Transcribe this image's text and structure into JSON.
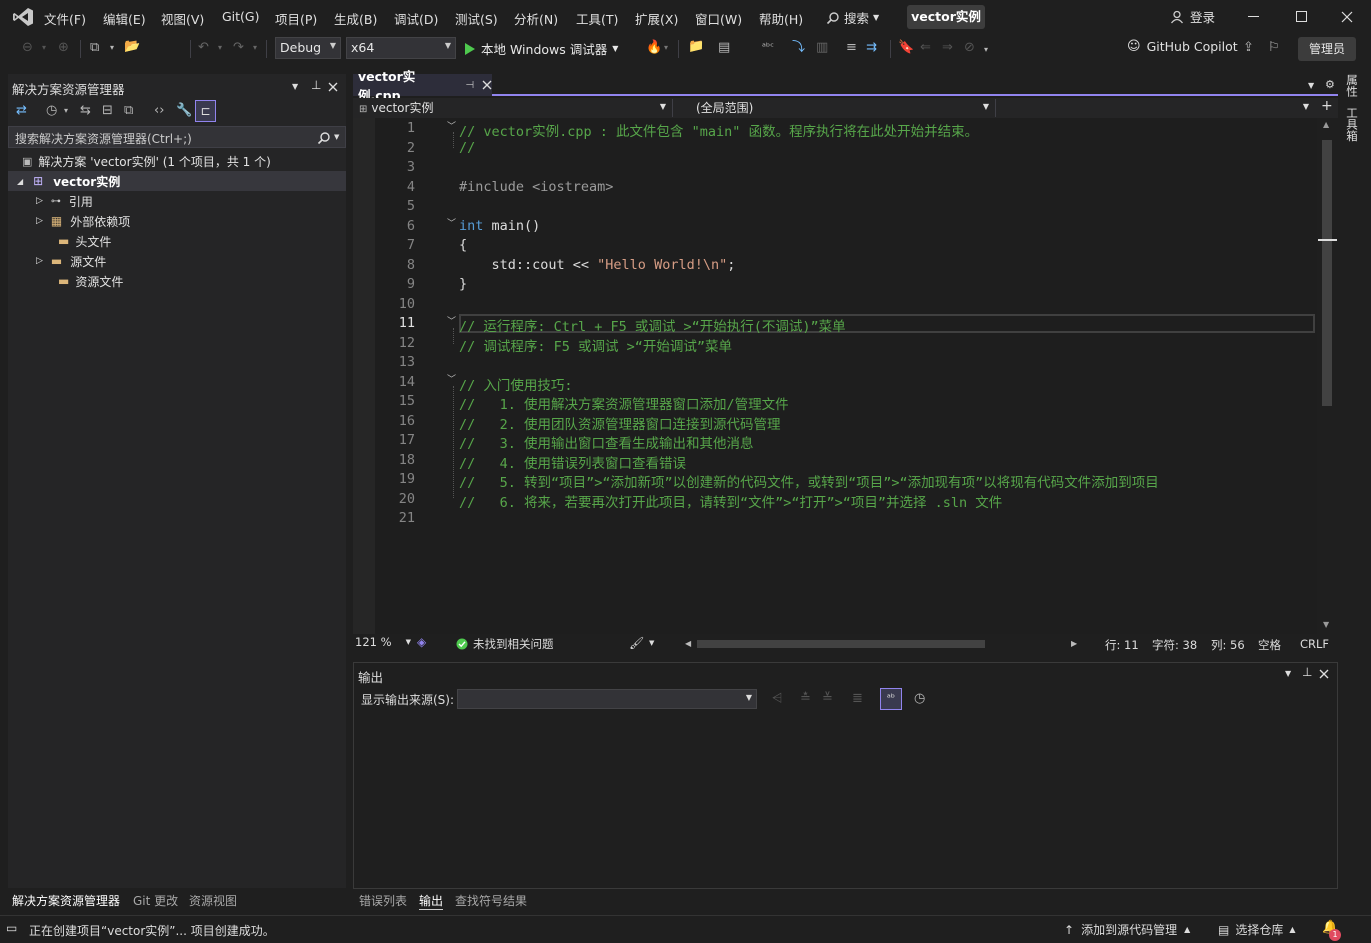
{
  "titlebar": {
    "menus": [
      "文件(F)",
      "编辑(E)",
      "视图(V)",
      "Git(G)",
      "项目(P)",
      "生成(B)",
      "调试(D)",
      "测试(S)",
      "分析(N)",
      "工具(T)",
      "扩展(X)",
      "窗口(W)",
      "帮助(H)"
    ],
    "search_label": "搜索",
    "project_name": "vector实例",
    "login_label": "登录"
  },
  "toolbar": {
    "config": "Debug",
    "platform": "x64",
    "run_label": "本地 Windows 调试器",
    "copilot_label": "GitHub Copilot",
    "admin_label": "管理员"
  },
  "solution_explorer": {
    "title": "解决方案资源管理器",
    "search_placeholder": "搜索解决方案资源管理器(Ctrl+;)",
    "solution_label": "解决方案 'vector实例' (1 个项目，共 1 个)",
    "project_label": "vector实例",
    "items": [
      "引用",
      "外部依赖项",
      "头文件",
      "源文件",
      "资源文件"
    ],
    "bottom_tabs": [
      "解决方案资源管理器",
      "Git 更改",
      "资源视图"
    ]
  },
  "editor": {
    "tab_label": "vector实例.cpp",
    "nav_project": "vector实例",
    "nav_scope": "(全局范围)",
    "line_numbers": [
      "1",
      "2",
      "3",
      "4",
      "5",
      "6",
      "7",
      "8",
      "9",
      "10",
      "11",
      "12",
      "13",
      "14",
      "15",
      "16",
      "17",
      "18",
      "19",
      "20",
      "21"
    ],
    "lines": {
      "l1": "// vector实例.cpp : 此文件包含 \"main\" 函数。程序执行将在此处开始并结束。",
      "l2": "//",
      "l4": "#include <iostream>",
      "l6_kw": "int",
      "l6_rest": " main()",
      "l7": "{",
      "l8_pre": "    std::cout << ",
      "l8_str": "\"Hello World!\\n\"",
      "l8_post": ";",
      "l9": "}",
      "l11": "// 运行程序: Ctrl + F5 或调试 >“开始执行(不调试)”菜单",
      "l12": "// 调试程序: F5 或调试 >“开始调试”菜单",
      "l14": "// 入门使用技巧:",
      "l15": "//   1. 使用解决方案资源管理器窗口添加/管理文件",
      "l16": "//   2. 使用团队资源管理器窗口连接到源代码管理",
      "l17": "//   3. 使用输出窗口查看生成输出和其他消息",
      "l18": "//   4. 使用错误列表窗口查看错误",
      "l19": "//   5. 转到“项目”>“添加新项”以创建新的代码文件，或转到“项目”>“添加现有项”以将现有代码文件添加到项目",
      "l20": "//   6. 将来，若要再次打开此项目，请转到“文件”>“打开”>“项目”并选择 .sln 文件"
    },
    "zoom": "121 %",
    "issues": "未找到相关问题",
    "row": "行: 11",
    "char": "字符: 38",
    "col": "列: 56",
    "whitespace": "空格",
    "line_ending": "CRLF"
  },
  "output": {
    "title": "输出",
    "source_label": "显示输出来源(S):",
    "bottom_tabs": [
      "错误列表",
      "输出",
      "查找符号结果"
    ]
  },
  "right_rail": [
    "属性",
    "工具箱"
  ],
  "statusbar": {
    "message": "正在创建项目“vector实例”... 项目创建成功。",
    "source_control": "添加到源代码管理",
    "repo": "选择仓库",
    "notifications": "1"
  },
  "colors": {
    "accent": "#9184ee",
    "comment": "#57a64a",
    "keyword": "#569cd6",
    "string": "#d69d85"
  }
}
